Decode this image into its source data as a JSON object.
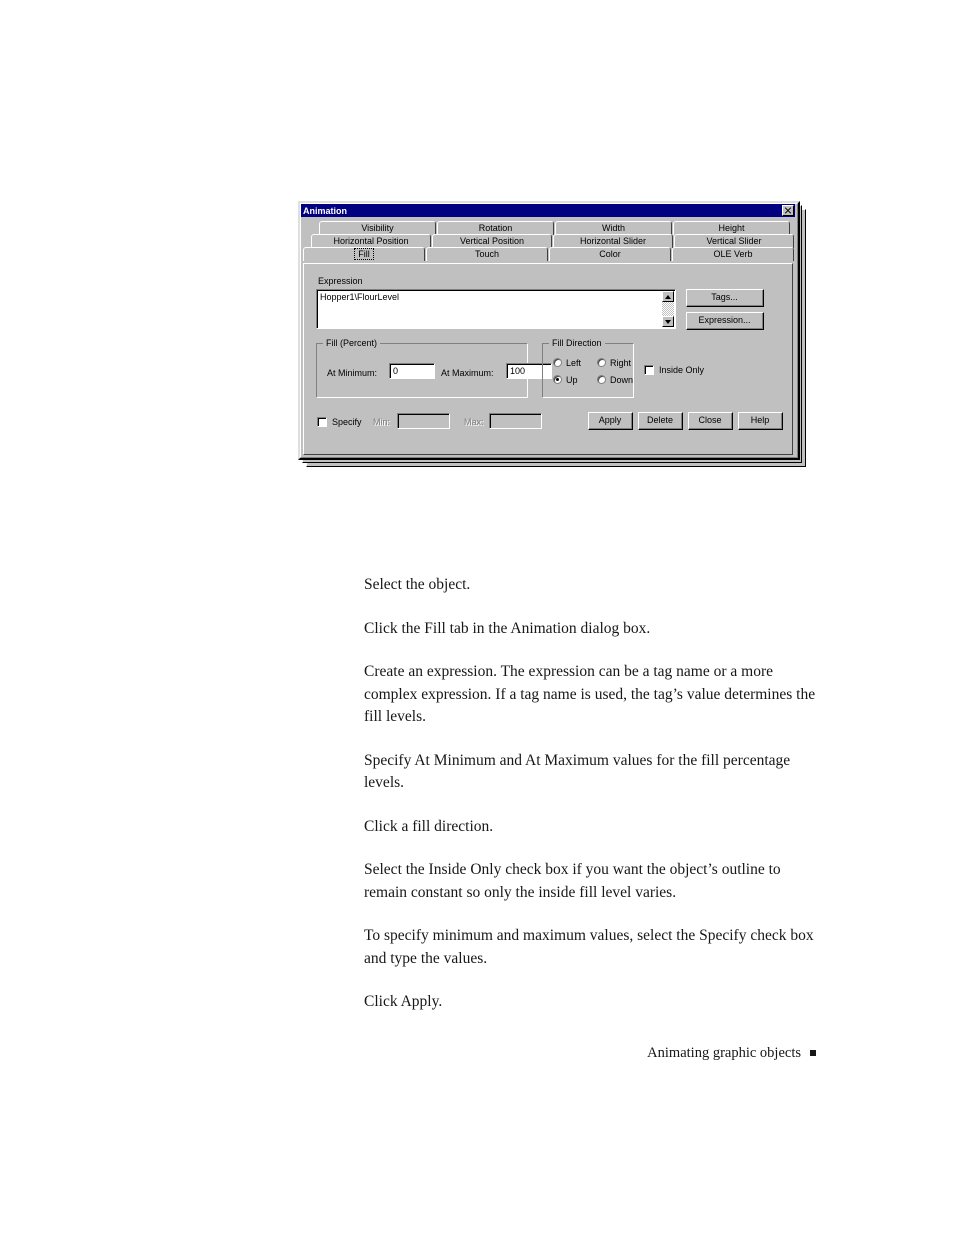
{
  "dialog": {
    "title": "Animation",
    "close_label": "x",
    "tab_rows": [
      [
        {
          "label": "Visibility",
          "accel": "V",
          "active": false
        },
        {
          "label": "Rotation",
          "accel": "R",
          "active": false
        },
        {
          "label": "Width",
          "accel": "W",
          "active": false
        },
        {
          "label": "Height",
          "accel": "H",
          "active": false
        }
      ],
      [
        {
          "label": "Horizontal Position",
          "accel": "P",
          "active": false
        },
        {
          "label": "Vertical Position",
          "accel": "e",
          "active": false
        },
        {
          "label": "Horizontal Slider",
          "accel": "z",
          "active": false
        },
        {
          "label": "Vertical Slider",
          "accel": "l",
          "active": false
        }
      ],
      [
        {
          "label": "Fill",
          "accel": "F",
          "active": true
        },
        {
          "label": "Touch",
          "accel": "u",
          "active": false
        },
        {
          "label": "Color",
          "accel": "C",
          "active": false
        },
        {
          "label": "OLE Verb",
          "accel": "L",
          "active": false
        }
      ]
    ],
    "expression": {
      "label": "Expression",
      "value": "Hopper1\\FlourLevel",
      "placeholder": ""
    },
    "buttons": {
      "tags": "Tags...",
      "expression": "Expression...",
      "apply": "Apply",
      "apply_accel": "A",
      "delete": "Delete",
      "delete_accel": "D",
      "close": "Close",
      "close_accel": "",
      "help": "Help",
      "help_accel": "H"
    },
    "fill_percent": {
      "caption": "Fill (Percent)",
      "at_minimum_label": "At Minimum:",
      "at_minimum_value": "0",
      "at_maximum_label": "At Maximum:",
      "at_maximum_value": "100"
    },
    "fill_direction": {
      "caption": "Fill Direction",
      "options": [
        {
          "label": "Left",
          "accel": "L",
          "checked": false
        },
        {
          "label": "Right",
          "accel": "R",
          "checked": false
        },
        {
          "label": "Up",
          "accel": "U",
          "checked": true
        },
        {
          "label": "Down",
          "accel": "D",
          "checked": false
        }
      ]
    },
    "inside_only": {
      "label": "Inside Only",
      "checked": false
    },
    "specify": {
      "label": "Specify",
      "accel": "S",
      "checked": false,
      "min_label": "Min:",
      "min_value": "",
      "max_label": "Max:",
      "max_value": "",
      "enabled": false
    },
    "colors": {
      "titlebar": "#000080",
      "face": "#c0c0c0",
      "field": "#ffffff",
      "disabled_text": "#808080"
    }
  },
  "document": {
    "paragraphs": [
      "Select the object.",
      "Click the Fill tab in the Animation dialog box.",
      "Create an expression. The expression can be a tag name or a more complex expression. If a tag name is used, the tag’s value determines the fill levels.",
      "Specify At Minimum and At Maximum values for the fill percentage levels.",
      "Click a fill direction.",
      "Select the Inside Only check box if you want the object’s outline to remain constant so only the inside fill level varies.",
      "To specify minimum and maximum values, select the Specify check box and type the values.",
      "Click Apply."
    ],
    "footer": "Animating graphic objects"
  }
}
